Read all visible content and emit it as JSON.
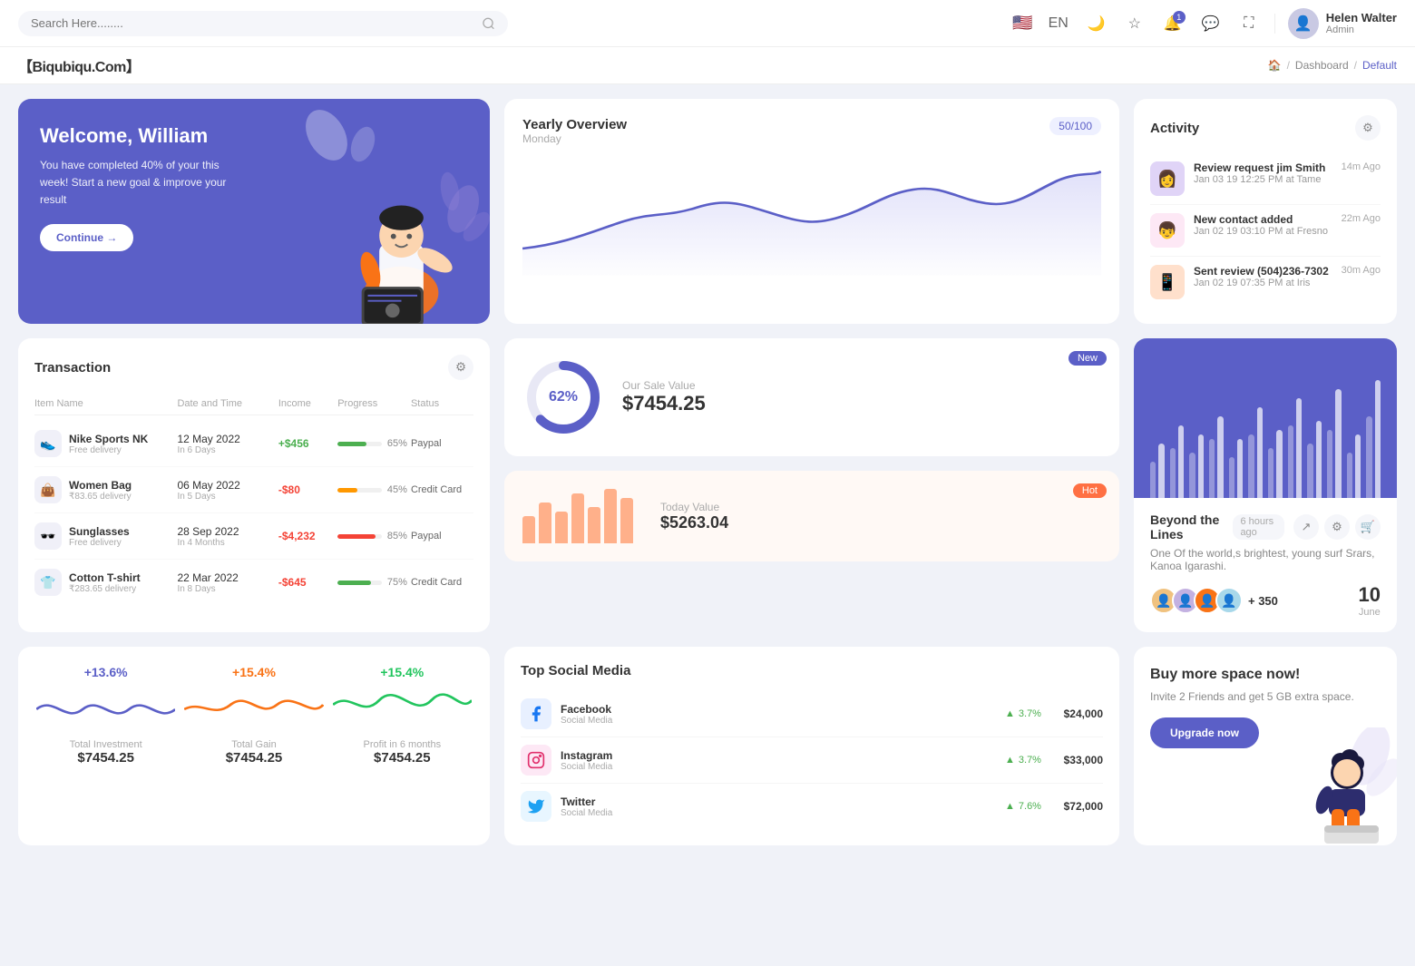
{
  "topbar": {
    "search_placeholder": "Search Here........",
    "language": "EN",
    "notification_count": "1",
    "user_name": "Helen Walter",
    "user_role": "Admin"
  },
  "breadcrumb": {
    "brand": "【Biqubiqu.Com】",
    "items": [
      "Dashboard",
      "Default"
    ]
  },
  "welcome": {
    "title": "Welcome, William",
    "subtitle": "You have completed 40% of your this week! Start a new goal & improve your result",
    "button": "Continue →"
  },
  "yearly": {
    "title": "Yearly Overview",
    "day": "Monday",
    "badge": "50/100"
  },
  "activity": {
    "title": "Activity",
    "items": [
      {
        "name": "Review request jim Smith",
        "sub": "Jan 03 19 12:25 PM at Tame",
        "time": "14m Ago"
      },
      {
        "name": "New contact added",
        "sub": "Jan 02 19 03:10 PM at Fresno",
        "time": "22m Ago"
      },
      {
        "name": "Sent review (504)236-7302",
        "sub": "Jan 02 19 07:35 PM at Iris",
        "time": "30m Ago"
      }
    ]
  },
  "transaction": {
    "title": "Transaction",
    "headers": [
      "Item Name",
      "Date and Time",
      "Income",
      "Progress",
      "Status"
    ],
    "rows": [
      {
        "name": "Nike Sports NK",
        "sub": "Free delivery",
        "date": "12 May 2022",
        "days": "In 6 Days",
        "income": "+$456",
        "progress": 65,
        "prog_color": "#4caf50",
        "status": "Paypal",
        "icon": "👟"
      },
      {
        "name": "Women Bag",
        "sub": "₹83.65 delivery",
        "date": "06 May 2022",
        "days": "In 5 Days",
        "income": "-$80",
        "progress": 45,
        "prog_color": "#ff9800",
        "status": "Credit Card",
        "icon": "👜"
      },
      {
        "name": "Sunglasses",
        "sub": "Free delivery",
        "date": "28 Sep 2022",
        "days": "In 4 Months",
        "income": "-$4,232",
        "progress": 85,
        "prog_color": "#f44336",
        "status": "Paypal",
        "icon": "🕶️"
      },
      {
        "name": "Cotton T-shirt",
        "sub": "₹283.65 delivery",
        "date": "22 Mar 2022",
        "days": "In 8 Days",
        "income": "-$645",
        "progress": 75,
        "prog_color": "#4caf50",
        "status": "Credit Card",
        "icon": "👕"
      }
    ]
  },
  "sale_value": {
    "title": "Our Sale Value",
    "amount": "$7454.25",
    "pct": "62%",
    "badge": "New"
  },
  "today_value": {
    "title": "Today Value",
    "amount": "$5263.04",
    "badge": "Hot",
    "bars": [
      30,
      45,
      35,
      55,
      40,
      60,
      50
    ]
  },
  "chart": {
    "bars": [
      {
        "light": 40,
        "dark": 60
      },
      {
        "light": 55,
        "dark": 80
      },
      {
        "light": 50,
        "dark": 70
      },
      {
        "light": 65,
        "dark": 90
      },
      {
        "light": 45,
        "dark": 65
      },
      {
        "light": 70,
        "dark": 100
      },
      {
        "light": 55,
        "dark": 75
      },
      {
        "light": 80,
        "dark": 110
      },
      {
        "light": 60,
        "dark": 85
      },
      {
        "light": 75,
        "dark": 120
      },
      {
        "light": 50,
        "dark": 70
      },
      {
        "light": 90,
        "dark": 130
      }
    ]
  },
  "beyond": {
    "title": "Beyond the Lines",
    "time": "6 hours ago",
    "desc": "One Of the world,s brightest, young surf Srars, Kanoa Igarashi.",
    "plus": "+ 350",
    "date_num": "10",
    "date_month": "June"
  },
  "stats": [
    {
      "pct": "+13.6%",
      "label": "Total Investment",
      "value": "$7454.25",
      "color": "#5b5fc7"
    },
    {
      "pct": "+15.4%",
      "label": "Total Gain",
      "value": "$7454.25",
      "color": "#f97316"
    },
    {
      "pct": "+15.4%",
      "label": "Profit in 6 months",
      "value": "$7454.25",
      "color": "#22c55e"
    }
  ],
  "social": {
    "title": "Top Social Media",
    "items": [
      {
        "name": "Facebook",
        "sub": "Social Media",
        "growth": "3.7%",
        "amount": "$24,000",
        "icon": "f",
        "bg": "fb"
      },
      {
        "name": "Instagram",
        "sub": "Social Media",
        "growth": "3.7%",
        "amount": "$33,000",
        "icon": "ig",
        "bg": "ig"
      },
      {
        "name": "Twitter",
        "sub": "Social Media",
        "growth": "7.6%",
        "amount": "$72,000",
        "icon": "tw",
        "bg": "tw"
      }
    ]
  },
  "promo": {
    "title": "Buy more space now!",
    "desc": "Invite 2 Friends and get 5 GB extra space.",
    "button": "Upgrade now"
  }
}
